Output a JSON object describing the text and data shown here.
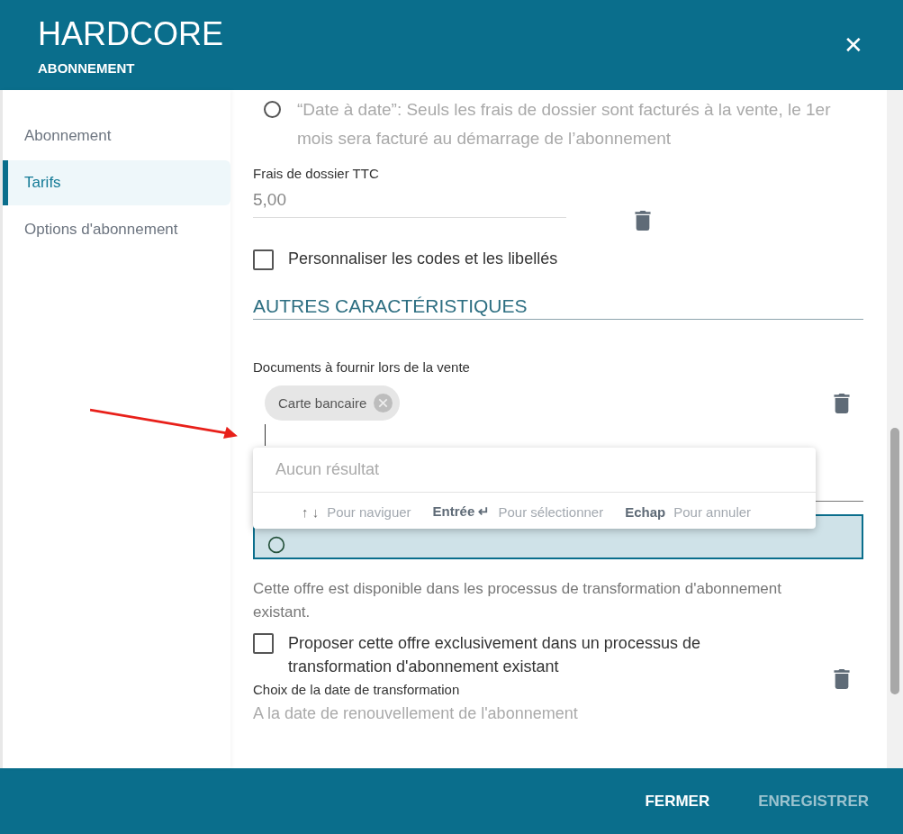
{
  "header": {
    "title": "HARDCORE",
    "subtitle": "ABONNEMENT",
    "close": "✕"
  },
  "sidebar": {
    "items": [
      {
        "label": "Abonnement",
        "selected": false
      },
      {
        "label": "Tarifs",
        "selected": true
      },
      {
        "label": "Options d'abonnement",
        "selected": false
      }
    ]
  },
  "radio": {
    "label": "“Date à date”: Seuls les frais de dossier sont facturés à la vente, le 1er mois sera facturé au démarrage de l’abonnement",
    "selected": false
  },
  "fee": {
    "label": "Frais de dossier TTC",
    "value": "5,00"
  },
  "custom_checkbox": {
    "label": "Personnaliser les codes et les libellés",
    "checked": false
  },
  "section_title": "AUTRES CARACTÉRISTIQUES",
  "documents": {
    "label": "Documents à fournir lors de la vente",
    "chips": [
      "Carte bancaire"
    ]
  },
  "dropdown": {
    "empty": "Aucun résultat",
    "hints": [
      {
        "keys": "↑ ↓",
        "bold": false,
        "text": "Pour naviguer"
      },
      {
        "keys": "Entrée ↵",
        "bold": true,
        "text": "Pour sélectionner"
      },
      {
        "keys": "Echap",
        "bold": true,
        "text": "Pour annuler"
      }
    ]
  },
  "availability": "Cette offre est disponible dans les processus de transformation d'abonnement existant.",
  "exclusive_checkbox": {
    "label": "Proposer cette offre exclusivement dans un processus de transformation d'abonnement existant",
    "checked": false
  },
  "transform": {
    "label": "Choix de la date de transformation",
    "value": "A la date de renouvellement de l'abonnement"
  },
  "footer": {
    "buttons": [
      {
        "label": "FERMER",
        "disabled": false
      },
      {
        "label": "ENREGISTRER",
        "disabled": true
      }
    ]
  }
}
